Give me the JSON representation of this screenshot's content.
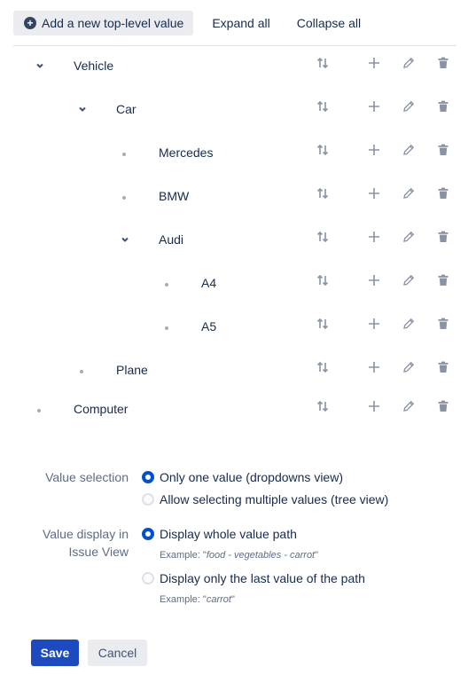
{
  "toolbar": {
    "add_label": "Add a new top-level value",
    "expand_label": "Expand all",
    "collapse_label": "Collapse all"
  },
  "tree": {
    "nodes": [
      {
        "label": "Vehicle",
        "depth": 0,
        "expandable": true,
        "expanded": true
      },
      {
        "label": "Car",
        "depth": 1,
        "expandable": true,
        "expanded": true
      },
      {
        "label": "Mercedes",
        "depth": 2,
        "expandable": false
      },
      {
        "label": "BMW",
        "depth": 2,
        "expandable": false
      },
      {
        "label": "Audi",
        "depth": 2,
        "expandable": true,
        "expanded": true
      },
      {
        "label": "A4",
        "depth": 3,
        "expandable": false
      },
      {
        "label": "A5",
        "depth": 3,
        "expandable": false
      },
      {
        "label": "Plane",
        "depth": 1,
        "expandable": false
      },
      {
        "label": "Computer",
        "depth": 0,
        "expandable": false
      }
    ],
    "row_actions": [
      "sort-icon",
      "plus-icon",
      "pencil-icon",
      "trash-icon"
    ]
  },
  "settings": {
    "value_selection": {
      "label": "Value selection",
      "options": [
        {
          "label": "Only one value (dropdowns view)",
          "selected": true
        },
        {
          "label": "Allow selecting multiple values (tree view)",
          "selected": false
        }
      ]
    },
    "value_display": {
      "label_line1": "Value display in",
      "label_line2": "Issue View",
      "options": [
        {
          "label": "Display whole value path",
          "selected": true,
          "example_prefix": "Example: \"",
          "example_value": "food - vegetables - carrot",
          "example_suffix": "\""
        },
        {
          "label": "Display only the last value of the path",
          "selected": false,
          "example_prefix": "Example: \"",
          "example_value": "carrot",
          "example_suffix": "\""
        }
      ]
    }
  },
  "footer": {
    "save_label": "Save",
    "cancel_label": "Cancel"
  },
  "colors": {
    "primary": "#1d4bbf",
    "icon_gray": "#8993a4",
    "text": "#172b4d"
  }
}
